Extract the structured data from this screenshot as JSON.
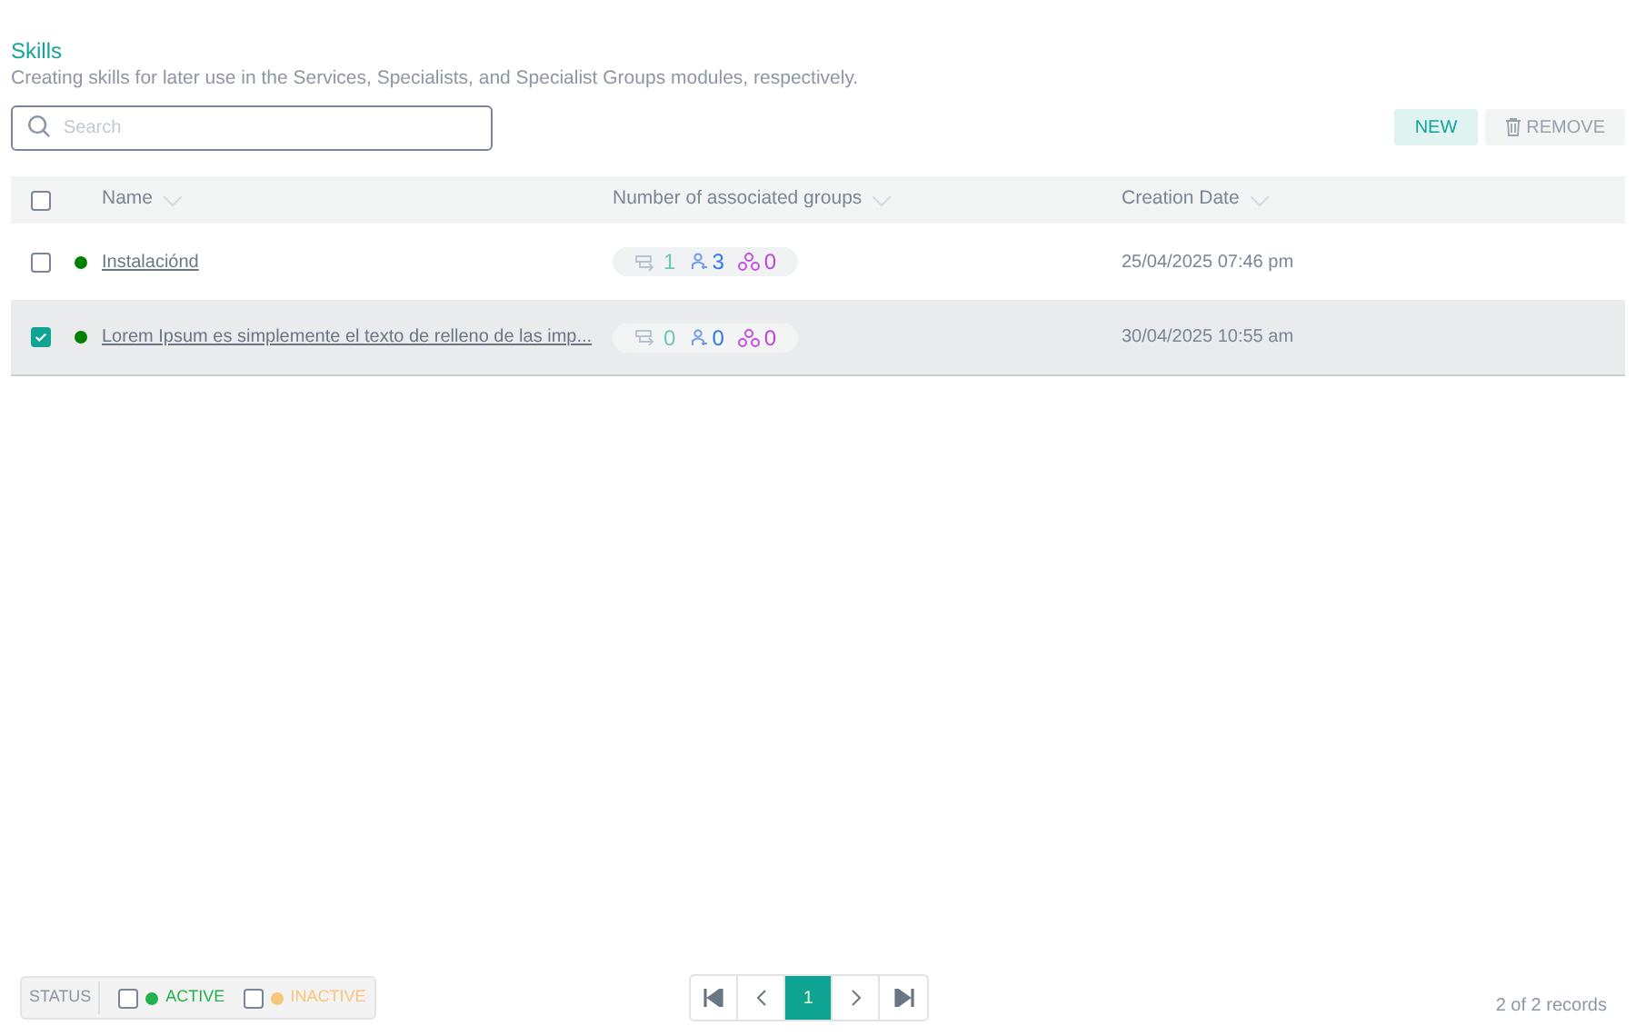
{
  "header": {
    "title": "Skills",
    "description": "Creating skills for later use in the Services, Specialists, and Specialist Groups modules, respectively."
  },
  "search": {
    "placeholder": "Search"
  },
  "buttons": [
    {
      "label": "NEW",
      "kind": "primary"
    },
    {
      "label": "REMOVE",
      "kind": "remove"
    }
  ],
  "table": {
    "select_all_checked": false,
    "columns": [
      "Name",
      "Number of associated groups",
      "Creation Date"
    ],
    "rows": [
      {
        "checked": false,
        "selected": false,
        "active": true,
        "name": "Instalaciónd",
        "counts": [
          {
            "kind": "service",
            "value": "1"
          },
          {
            "kind": "specialist",
            "value": "3"
          },
          {
            "kind": "group",
            "value": "0"
          }
        ],
        "date": "25/04/2025 07:46 pm"
      },
      {
        "checked": true,
        "selected": true,
        "active": true,
        "name": "Lorem Ipsum es simplemente el texto de relleno de las imp...",
        "counts": [
          {
            "kind": "service",
            "value": "0"
          },
          {
            "kind": "specialist",
            "value": "0"
          },
          {
            "kind": "group",
            "value": "0"
          }
        ],
        "date": "30/04/2025 10:55 am"
      }
    ]
  },
  "status_filter": {
    "label": "STATUS",
    "options": [
      {
        "label": "ACTIVE",
        "checked": false,
        "color": "#22b14c"
      },
      {
        "label": "INACTIVE",
        "checked": false,
        "color": "#f7c67a"
      }
    ]
  },
  "pagination": {
    "pages": [
      {
        "label": "1",
        "selected": true
      }
    ]
  },
  "records": "2 of 2 records"
}
